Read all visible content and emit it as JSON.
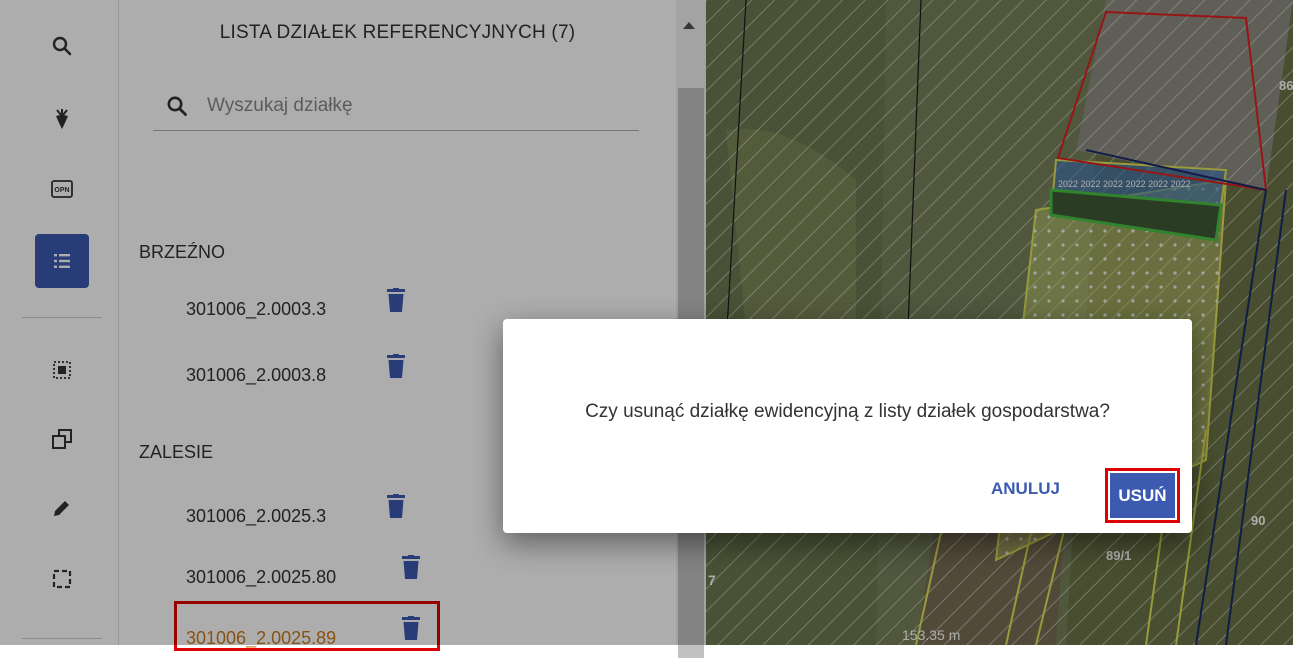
{
  "panel": {
    "title": "LISTA DZIAŁEK REFERENCYJNYCH (7)",
    "search_placeholder": "Wyszukaj działkę",
    "groups": [
      {
        "name": "BRZEŹNO",
        "plots": [
          "301006_2.0003.3",
          "301006_2.0003.8"
        ]
      },
      {
        "name": "ZALESIE",
        "plots": [
          "301006_2.0025.3",
          "301006_2.0025.80",
          "301006_2.0025.89"
        ]
      }
    ]
  },
  "toolbar": {
    "items": [
      "search-icon",
      "beet-crop-icon",
      "opn-icon",
      "list-icon",
      "select-area-icon",
      "copy-icon",
      "pencil-icon",
      "selection-frame-icon"
    ],
    "opn_label": "OPN"
  },
  "map": {
    "labels": [
      "86",
      "90",
      "89/1",
      "7",
      "2022 2022 2022 2022 2022 2022"
    ],
    "scale": "153.35 m"
  },
  "dialog": {
    "message": "Czy usunąć działkę ewidencyjną z listy działek gospodarstwa?",
    "cancel_label": "ANULUJ",
    "delete_label": "USUŃ"
  },
  "colors": {
    "accent": "#3c5bb0",
    "highlight": "#e00000",
    "plot_highlight_text": "#c87a1c"
  }
}
